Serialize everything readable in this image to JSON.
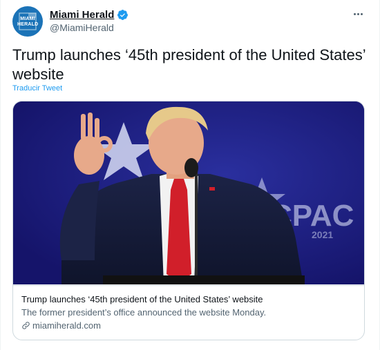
{
  "author": {
    "name": "Miami Herald",
    "handle": "@MiamiHerald",
    "avatar_text_line1": "MIAMI",
    "avatar_text_line2": "HERALD",
    "verified": true
  },
  "tweet": {
    "text": "Trump launches ‘45th president of the United States’ website",
    "translate_label": "Traducir Tweet"
  },
  "card": {
    "title": "Trump launches ‘45th president of the United States’ website",
    "description": "The former president’s office announced the website Monday.",
    "domain": "miamiherald.com",
    "image_backdrop_text": "CPAC",
    "image_backdrop_year": "2021"
  },
  "icons": {
    "more": "more-horizontal-icon",
    "verified": "verified-badge-icon",
    "link": "link-icon"
  },
  "colors": {
    "accent": "#1d9bf0",
    "secondary_text": "#536471",
    "avatar_bg": "#1b73b7",
    "image_bg": "#1f1e7c"
  }
}
